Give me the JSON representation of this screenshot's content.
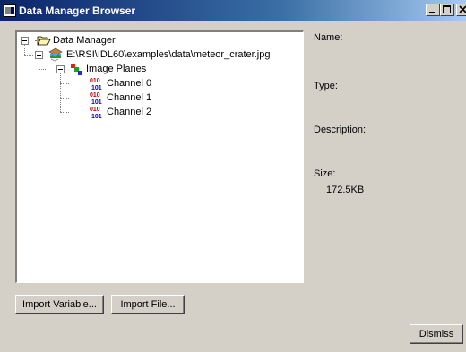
{
  "window": {
    "title": "Data Manager Browser",
    "controls": [
      "minimize-icon",
      "maximize-icon",
      "close-icon"
    ]
  },
  "tree": {
    "root": {
      "label": "Data Manager",
      "icon": "folder-open-icon"
    },
    "file": {
      "label": "E:\\RSI\\IDL60\\examples\\data\\meteor_crater.jpg",
      "icon": "image-file-icon"
    },
    "planes": {
      "label": "Image Planes",
      "icon": "image-planes-icon"
    },
    "channels": [
      {
        "label": "Channel 0",
        "icon": "binary-data-icon"
      },
      {
        "label": "Channel 1",
        "icon": "binary-data-icon"
      },
      {
        "label": "Channel 2",
        "icon": "binary-data-icon"
      }
    ]
  },
  "properties": {
    "name_label": "Name:",
    "type_label": "Type:",
    "description_label": "Description:",
    "size_label": "Size:",
    "size_value": "172.5KB"
  },
  "buttons": {
    "import_variable": "Import Variable...",
    "import_file": "Import File...",
    "dismiss": "Dismiss"
  }
}
